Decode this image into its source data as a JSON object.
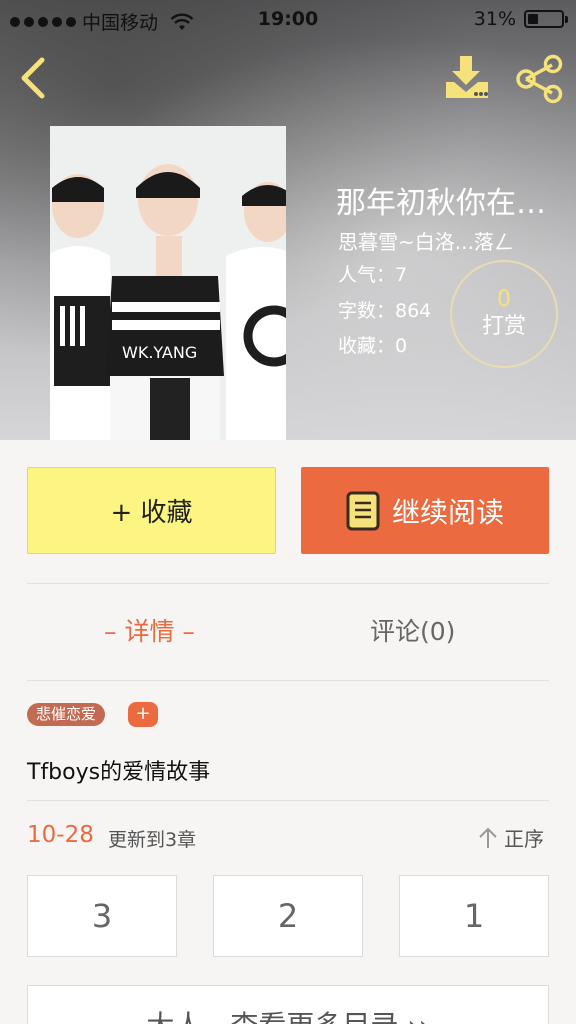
{
  "status_bar": {
    "carrier": "中国移动",
    "time": "19:00",
    "battery_text": "31%",
    "battery_level": 0.31
  },
  "nav": {
    "back_icon": "chevron-left-icon",
    "download_icon": "download-icon",
    "share_icon": "share-icon",
    "icon_color": "#f6e27a"
  },
  "book": {
    "title": "那年初秋你在…",
    "author": "思暮雪~白洛...落ㄥ",
    "popularity": "人气：7",
    "word_count": "字数：864",
    "collections": "收藏：0",
    "tip_count": "0",
    "tip_label": "打赏"
  },
  "actions": {
    "collect_label": "+ 收藏",
    "read_label": "继续阅读",
    "collect_color": "#fdf582",
    "read_color": "#ec6a3f"
  },
  "tabs": {
    "details": "– 详情 –",
    "comments": "评论(0)"
  },
  "tags": {
    "genre": "悲催恋爱",
    "add": "+"
  },
  "summary": "Tfboys的爱情故事",
  "updates": {
    "date": "10-28",
    "text": "更新到3章",
    "sort_label": "正序"
  },
  "chapters": [
    "3",
    "2",
    "1"
  ],
  "more_label": "大人，查看更多目录 ››"
}
